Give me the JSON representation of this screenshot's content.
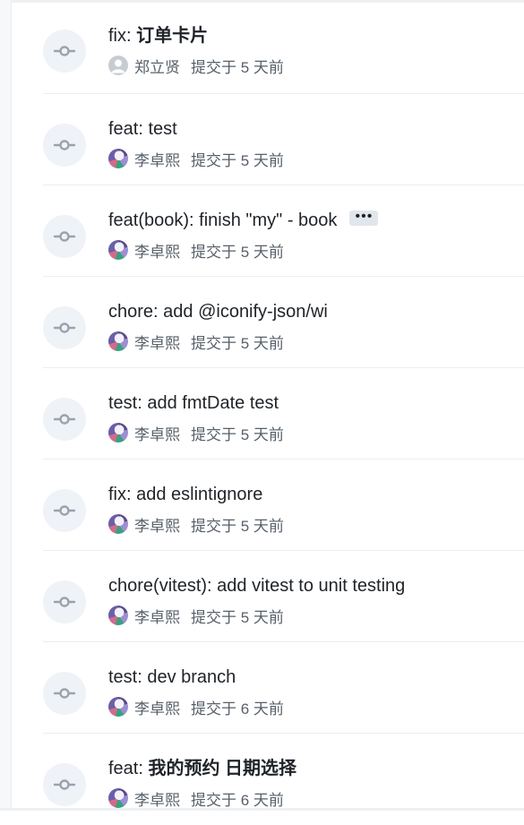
{
  "commits": [
    {
      "title_prefix": "fix: ",
      "title_cjk": "订单卡片",
      "author": "郑立贤",
      "avatar": "default",
      "time": "提交于 5 天前"
    },
    {
      "title_prefix": "feat: test",
      "title_cjk": "",
      "author": "李卓熙",
      "avatar": "photo",
      "time": "提交于 5 天前"
    },
    {
      "title_prefix": "feat(book): finish \"my\" - book",
      "title_cjk": "",
      "author": "李卓熙",
      "avatar": "photo",
      "time": "提交于 5 天前",
      "more_label": "•••"
    },
    {
      "title_prefix": "chore: add @iconify-json/wi",
      "title_cjk": "",
      "author": "李卓熙",
      "avatar": "photo",
      "time": "提交于 5 天前"
    },
    {
      "title_prefix": "test: add fmtDate test",
      "title_cjk": "",
      "author": "李卓熙",
      "avatar": "photo",
      "time": "提交于 5 天前"
    },
    {
      "title_prefix": "fix: add eslintignore",
      "title_cjk": "",
      "author": "李卓熙",
      "avatar": "photo",
      "time": "提交于 5 天前"
    },
    {
      "title_prefix": "chore(vitest): add vitest to unit testing",
      "title_cjk": "",
      "author": "李卓熙",
      "avatar": "photo",
      "time": "提交于 5 天前"
    },
    {
      "title_prefix": "test: dev branch",
      "title_cjk": "",
      "author": "李卓熙",
      "avatar": "photo",
      "time": "提交于 6 天前"
    },
    {
      "title_prefix": "feat: ",
      "title_cjk": "我的预约 日期选择",
      "author": "李卓熙",
      "avatar": "photo",
      "time": "提交于 6 天前"
    }
  ],
  "icons": {
    "commit": "git-commit-icon"
  },
  "colors": {
    "icon_bg": "#eff2f7",
    "icon_stroke": "#9aa3ad",
    "text": "#1f2328",
    "muted": "#57606a",
    "divider": "#eaeef2"
  }
}
